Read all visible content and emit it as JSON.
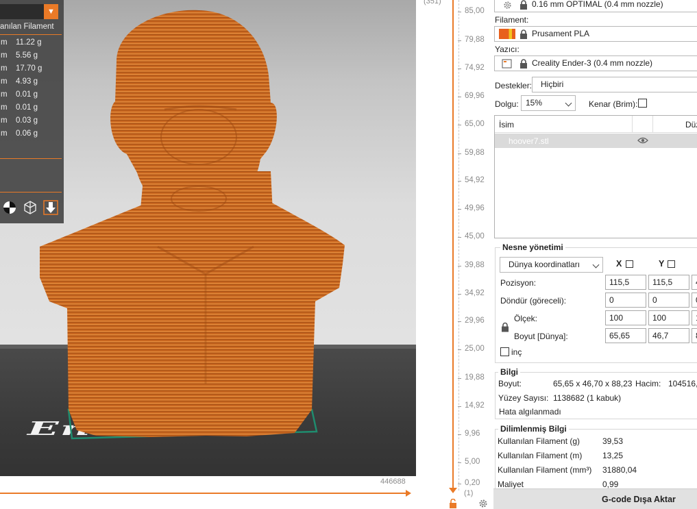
{
  "legend": {
    "title": "anılan Filament",
    "rows": [
      {
        "unit": "m",
        "value": "11.22 g"
      },
      {
        "unit": "m",
        "value": "5.56 g"
      },
      {
        "unit": "m",
        "value": "17.70 g"
      },
      {
        "unit": "m",
        "value": "4.93 g"
      },
      {
        "unit": "m",
        "value": "0.01 g"
      },
      {
        "unit": "m",
        "value": "0.01 g"
      },
      {
        "unit": "m",
        "value": "0.03 g"
      },
      {
        "unit": "m",
        "value": "0.06 g"
      }
    ],
    "icons": [
      "cog-pie-icon",
      "cube-outline-icon",
      "export-arrow-icon"
    ]
  },
  "viewport": {
    "bed_logo": "Ender",
    "layer_count": "446688"
  },
  "vslider": {
    "top_label": "(351)",
    "bottom_label": "(1)",
    "ticks": [
      "85,00",
      "79,88",
      "74,92",
      "69,96",
      "65,00",
      "59,88",
      "54,92",
      "49,96",
      "45,00",
      "39,88",
      "34,92",
      "29,96",
      "25,00",
      "19,88",
      "14,92",
      "9,96",
      "5,00",
      "0,20"
    ]
  },
  "sidebar": {
    "print_profile": "0.16 mm OPTIMAL (0.4 mm nozzle)",
    "filament_label": "Filament:",
    "filament_value": "Prusament PLA",
    "printer_label": "Yazıcı:",
    "printer_value": "Creality Ender-3 (0.4 mm nozzle)",
    "supports_label": "Destekler:",
    "supports_value": "Hiçbiri",
    "infill_label": "Dolgu:",
    "infill_value": "15%",
    "brim_label": "Kenar (Brim):",
    "object_list": {
      "col_name": "İsim",
      "col_edit": "Düz",
      "item": "hoover7.stl"
    },
    "object_mgmt": {
      "title": "Nesne yönetimi",
      "coord_system": "Dünya koordinatları",
      "axis_x": "X",
      "axis_y": "Y",
      "position_label": "Pozisyon:",
      "rotate_label": "Döndür (göreceli):",
      "scale_label": "Ölçek:",
      "size_label": "Boyut [Dünya]:",
      "inch_label": "inç",
      "position": [
        "115,5",
        "115,5",
        "4"
      ],
      "rotate": [
        "0",
        "0",
        "0"
      ],
      "scale": [
        "100",
        "100",
        "1"
      ],
      "size": [
        "65,65",
        "46,7",
        "8"
      ]
    },
    "info": {
      "title": "Bilgi",
      "size_label": "Boyut:",
      "size_value": "65,65 x 46,70 x 88,23",
      "volume_label": "Hacim:",
      "volume_value": "104516,",
      "faces_label": "Yüzey Sayısı:",
      "faces_value": "1138682 (1 kabuk)",
      "errors": "Hata algılanmadı"
    },
    "sliced_info": {
      "title": "Dilimlenmiş Bilgi",
      "filament_g_label": "Kullanılan Filament (g)",
      "filament_g": "39,53",
      "filament_m_label": "Kullanılan Filament (m)",
      "filament_m": "13,25",
      "filament_mm3_label": "Kullanılan Filament (mm³)",
      "filament_mm3": "31880,04",
      "cost_label": "Maliyet",
      "cost": "0,99"
    },
    "export_button": "G-code Dışa Aktar"
  },
  "colors": {
    "accent": "#ea7a27",
    "model": "#c8661f",
    "filament_swatch": "#e8601c",
    "bed": "#3e3e3e"
  }
}
